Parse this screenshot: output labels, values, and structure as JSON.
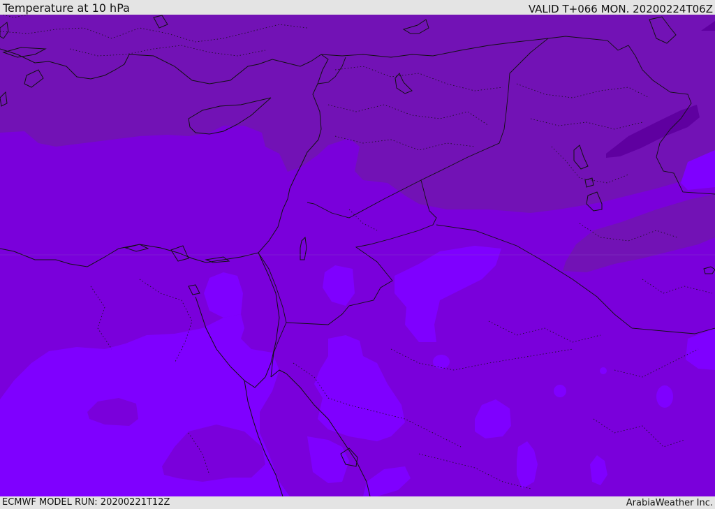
{
  "header": {
    "title": "Temperature at 10 hPa",
    "valid_time": "VALID T+066 MON. 20200224T06Z"
  },
  "footer": {
    "model_run": "ECMWF MODEL RUN: 20200221T12Z",
    "credit": "ArabiaWeather Inc."
  },
  "map": {
    "colors": {
      "darkest": "#5f00a0",
      "dark": "#7212b5",
      "mid": "#7a00db",
      "light": "#7f00ff",
      "border": "#111111"
    }
  }
}
